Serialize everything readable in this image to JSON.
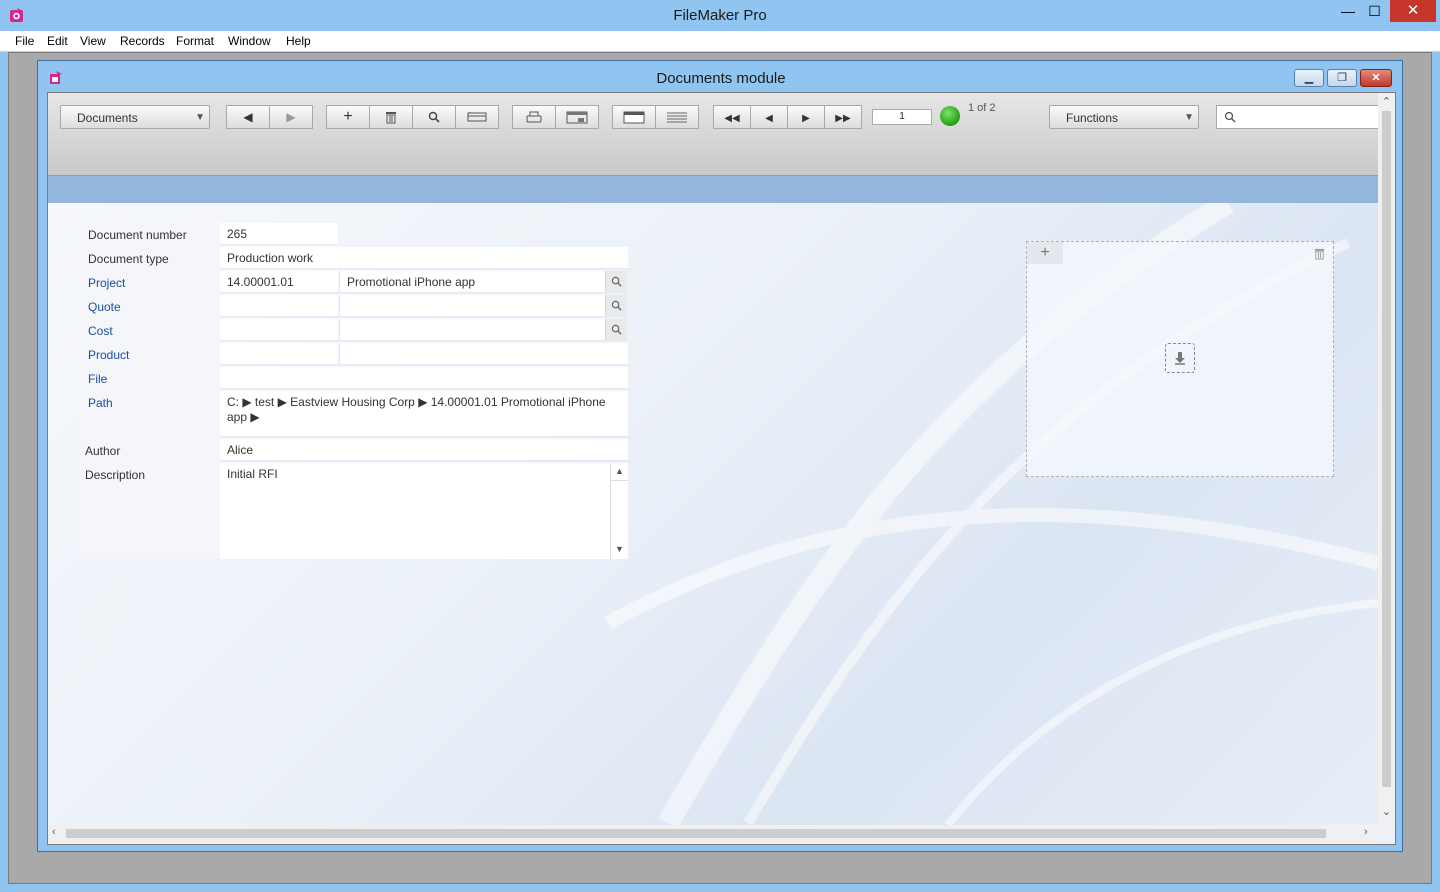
{
  "app": {
    "title": "FileMaker Pro"
  },
  "menu": [
    "File",
    "Edit",
    "View",
    "Records",
    "Format",
    "Window",
    "Help"
  ],
  "window": {
    "title": "Documents module"
  },
  "toolbar": {
    "layout_select": "Documents",
    "record_input": "1",
    "record_count": "1 of 2",
    "functions_select": "Functions",
    "search_placeholder": ""
  },
  "form": {
    "document_number": {
      "label": "Document number",
      "value": "265"
    },
    "document_type": {
      "label": "Document type",
      "value": "Production work"
    },
    "project": {
      "label": "Project",
      "code": "14.00001.01",
      "name": "Promotional iPhone app"
    },
    "quote": {
      "label": "Quote",
      "code": "",
      "name": ""
    },
    "cost": {
      "label": "Cost",
      "code": "",
      "name": ""
    },
    "product": {
      "label": "Product",
      "code": "",
      "name": ""
    },
    "file": {
      "label": "File",
      "value": ""
    },
    "path": {
      "label": "Path",
      "value": "C: ▶ test ▶ Eastview Housing Corp ▶ 14.00001.01 Promotional iPhone app ▶"
    },
    "author": {
      "label": "Author",
      "value": "Alice"
    },
    "description": {
      "label": "Description",
      "value": "Initial RFI"
    }
  },
  "colors": {
    "title_bar": "#8fc5f0",
    "accent_blue": "#92b6dc",
    "link_label": "#1a4fa0",
    "status_ok": "#2eaa1e",
    "close": "#c7362b"
  },
  "icons": [
    "app-icon",
    "minimize-icon",
    "maximize-icon",
    "close-icon",
    "prev-arrow-icon",
    "next-arrow-icon",
    "add-icon",
    "trash-icon",
    "search-icon",
    "print-icon",
    "first-record-icon",
    "last-record-icon",
    "download-icon"
  ]
}
